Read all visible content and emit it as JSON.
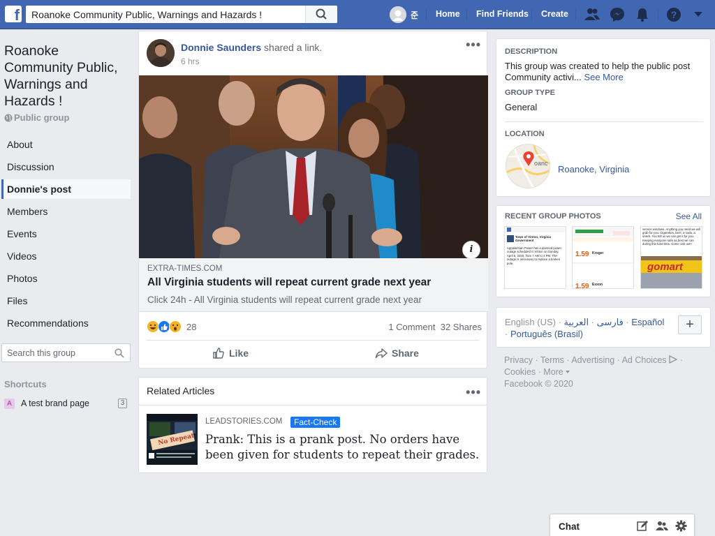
{
  "topbar": {
    "search_value": "Roanoke Community Public, Warnings and Hazards !",
    "profile_name": "준",
    "nav": [
      "Home",
      "Find Friends",
      "Create"
    ]
  },
  "left": {
    "group_title": "Roanoke Community Public, Warnings and Hazards !",
    "group_privacy": "Public group",
    "nav_items": [
      "About",
      "Discussion",
      "Donnie's post",
      "Members",
      "Events",
      "Videos",
      "Photos",
      "Files",
      "Recommendations"
    ],
    "active_index": 2,
    "search_placeholder": "Search this group",
    "shortcuts_heading": "Shortcuts",
    "shortcut": {
      "icon_letter": "A",
      "name": "A test brand page",
      "count": "3"
    }
  },
  "post": {
    "author": "Donnie Saunders",
    "action": "shared a link.",
    "time": "6 hrs",
    "link_domain": "EXTRA-TIMES.COM",
    "link_title": "All Virginia students will repeat current grade next year",
    "link_desc": "Click 24h - All Virginia students will repeat current grade next year",
    "reaction_count": "28",
    "stats": "1 Comment  32 Shares",
    "like_label": "Like",
    "share_label": "Share"
  },
  "related": {
    "heading": "Related Articles",
    "thumb_text": "No Repeat",
    "domain": "LEADSTORIES.COM",
    "badge": "Fact-Check",
    "text": "Prank: This is a prank post. No orders have been given for students to repeat their grades."
  },
  "about": {
    "description_heading": "DESCRIPTION",
    "description": "This group was created to help the public post Community activi...",
    "see_more": "See More",
    "type_heading": "GROUP TYPE",
    "type": "General",
    "location_heading": "LOCATION",
    "map_label": "oanc",
    "location": "Roanoke, Virginia"
  },
  "photos": {
    "heading": "RECENT GROUP PHOTOS",
    "see_all": "See All",
    "thumb1_title": "Town of Vinton, Virginia Government",
    "thumb1_body": "Appalachian Power has a planned power outage scheduled in Vinton on Sunday, April 5, 2020, from 7 AM to 4 PM. The outage is necessary to replace a broken pole.",
    "thumb2_price1": "1.59",
    "thumb2_price2": "1.59",
    "thumb2_name1": "Kroger",
    "thumb2_name2": "Exxon",
    "thumb3_body": "service windows. Anything you need we will grab for you. Cigarettes, beer, a soda, a snack. You tell us we can get it for you. Keeping everyone safe as best we can during this hard time. Come visit us!!!",
    "thumb3_brand": "gomart"
  },
  "languages": {
    "current": "English (US)",
    "others": [
      "فارسی",
      "العربية",
      "Español",
      "Português (Brasil)"
    ],
    "plus": "+"
  },
  "footer": {
    "links": [
      "Privacy",
      "Terms",
      "Advertising",
      "Ad Choices",
      "Cookies",
      "More"
    ],
    "copyright": "Facebook © 2020"
  },
  "chat": {
    "label": "Chat"
  }
}
